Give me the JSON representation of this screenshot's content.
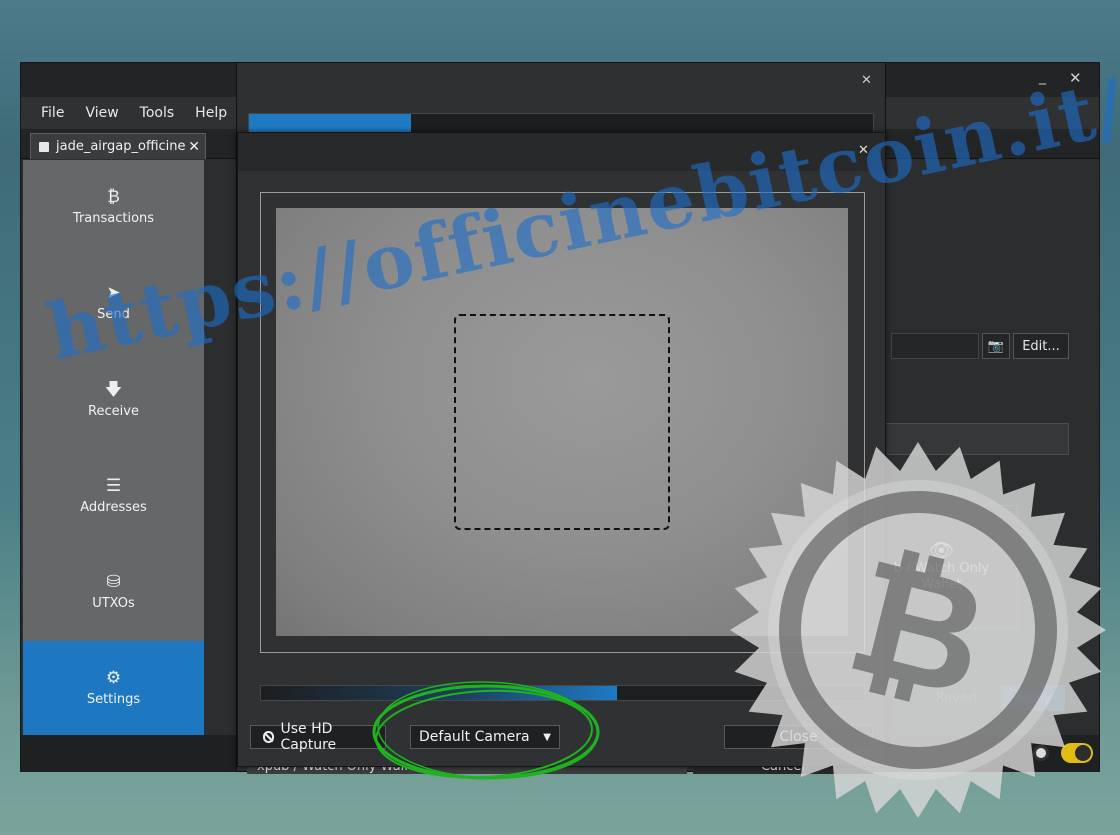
{
  "main_window": {
    "menu": [
      "File",
      "View",
      "Tools",
      "Help"
    ],
    "wallet_tab": "jade_airgap_officine",
    "window_buttons": {
      "minimize": "_",
      "close": "✕"
    },
    "sidebar": [
      {
        "label": "Transactions",
        "icon": "bitcoin-icon",
        "glyph": "₿"
      },
      {
        "label": "Send",
        "icon": "paper-plane-icon",
        "glyph": "➤"
      },
      {
        "label": "Receive",
        "icon": "arrow-down-icon",
        "glyph": "🡇"
      },
      {
        "label": "Addresses",
        "icon": "list-icon",
        "glyph": "☰"
      },
      {
        "label": "UTXOs",
        "icon": "coins-icon",
        "glyph": "⛁"
      },
      {
        "label": "Settings",
        "icon": "gear-icon",
        "glyph": "⚙",
        "active": true
      }
    ],
    "settings": {
      "edit_button": "Edit...",
      "watch_card_line1": "b / Watch Only",
      "watch_card_line2": "Wallet",
      "revert_button": "Revert",
      "apply_button": "Apply",
      "ellipsis_button": ".."
    }
  },
  "progress_dialog": {
    "progress_fraction": 0.26,
    "bottom_label": "xpub / Watch Only Wallet",
    "cancel_button": "Cancel"
  },
  "qr_dialog": {
    "close_glyph": "✕",
    "hd_capture_button": "Use HD Capture",
    "camera_select_value": "Default Camera",
    "close_button": "Close",
    "scan_progress_fraction": 0.59
  },
  "watermark": {
    "text": "https://officinebitcoin.it/"
  },
  "colors": {
    "accent": "#1d78c1",
    "annotation_green": "#1fb31f",
    "toggle_yellow": "#e0bc15"
  }
}
